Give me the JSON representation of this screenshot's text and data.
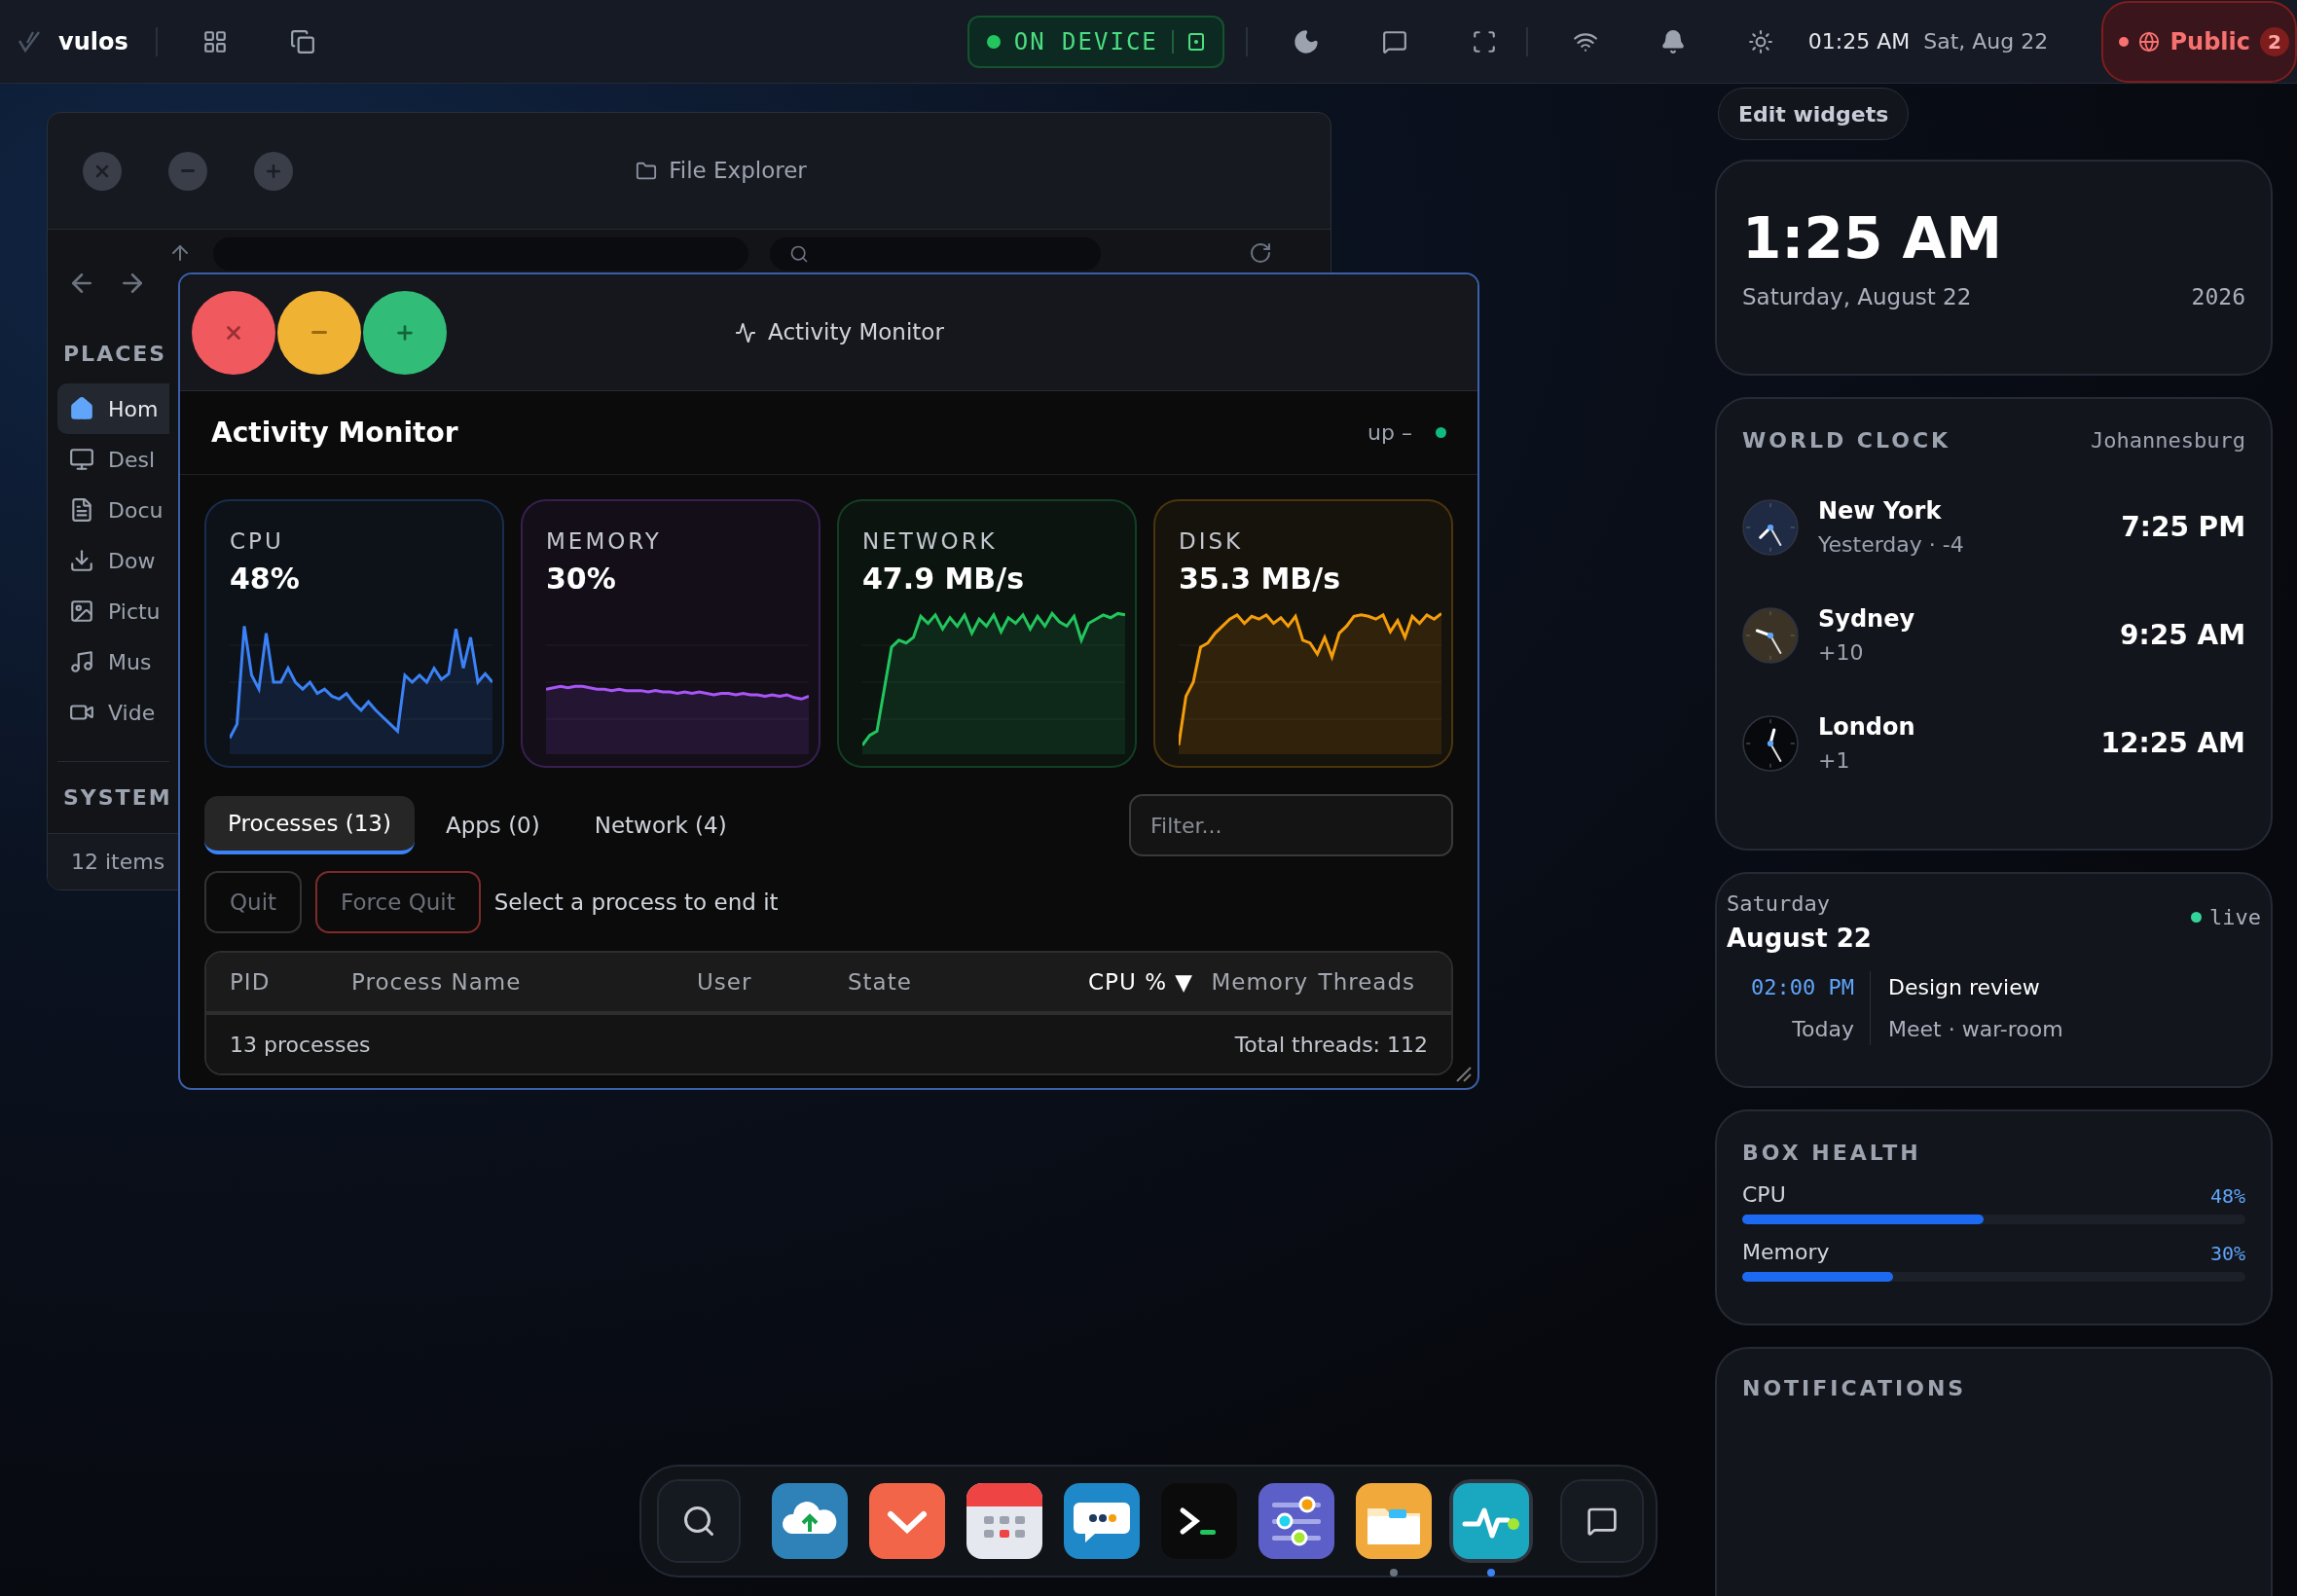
{
  "top_bar": {
    "brand": "vulos",
    "status": {
      "label": "ON DEVICE",
      "on": true
    },
    "time": "01:25 AM",
    "date": "Sat, Aug 22",
    "network": {
      "label": "Public",
      "count": "2"
    }
  },
  "file_explorer": {
    "title": "File Explorer",
    "sections": [
      {
        "heading": "PLACES",
        "items": [
          {
            "label": "Hom",
            "selected": true
          },
          {
            "label": "Desl",
            "selected": false
          },
          {
            "label": "Docu",
            "selected": false
          },
          {
            "label": "Dow",
            "selected": false
          },
          {
            "label": "Pictu",
            "selected": false
          },
          {
            "label": "Mus",
            "selected": false
          },
          {
            "label": "Vide",
            "selected": false
          }
        ]
      },
      {
        "heading": "SYSTEM"
      }
    ],
    "status": "12 items"
  },
  "activity_monitor": {
    "title": "Activity Monitor",
    "heading": "Activity Monitor",
    "uptime": "up –",
    "online": true,
    "metrics": [
      {
        "label": "CPU",
        "value": "48%",
        "color": "#3b82f6"
      },
      {
        "label": "MEMORY",
        "value": "30%",
        "color": "#a855f7"
      },
      {
        "label": "NETWORK",
        "value": "47.9 MB/s",
        "color": "#22c55e"
      },
      {
        "label": "DISK",
        "value": "35.3 MB/s",
        "color": "#f59e0b"
      }
    ],
    "tabs": [
      {
        "label": "Processes (13)",
        "selected": true
      },
      {
        "label": "Apps (0)",
        "selected": false
      },
      {
        "label": "Network (4)",
        "selected": false
      }
    ],
    "filter": {
      "placeholder": "Filter..."
    },
    "actions": [
      {
        "label": "Quit",
        "kind": "normal",
        "disabled": true
      },
      {
        "label": "Force Quit",
        "kind": "danger",
        "disabled": true
      }
    ],
    "hint": "Select a process to end it",
    "table": {
      "columns": [
        {
          "label": "PID",
          "selected": false
        },
        {
          "label": "Process Name",
          "selected": false
        },
        {
          "label": "User",
          "selected": false
        },
        {
          "label": "State",
          "selected": false
        },
        {
          "label": "CPU %",
          "selected": true,
          "arrow": "▼"
        },
        {
          "label": "Memory",
          "selected": false
        },
        {
          "label": "Threads",
          "selected": false
        }
      ],
      "footer": {
        "count": "13 processes",
        "threads": "Total threads: 112"
      }
    }
  },
  "widgets": {
    "edit_button": "Edit widgets",
    "clock": {
      "time": "1:25 AM",
      "date": "Saturday, August 22",
      "year": "2026"
    },
    "world_clock": {
      "title": "WORLD CLOCK",
      "home": "Johannesburg",
      "cities": [
        {
          "name": "New York",
          "offset": "Yesterday · -4",
          "time": "7:25 PM",
          "color": "#1f2b45"
        },
        {
          "name": "Sydney",
          "offset": "+10",
          "time": "9:25 AM",
          "color": "#3b3326"
        },
        {
          "name": "London",
          "offset": "+1",
          "time": "12:25 AM",
          "color": "#08090c"
        }
      ]
    },
    "calendar": {
      "weekday": "Saturday",
      "date": "August 22",
      "live": "live",
      "event": {
        "time": "02:00 PM",
        "day": "Today",
        "title": "Design review",
        "location": "Meet · war-room"
      }
    },
    "box_health": {
      "title": "BOX HEALTH",
      "meters": [
        {
          "label": "CPU",
          "reading": "48%",
          "level": 0.48
        },
        {
          "label": "Memory",
          "reading": "30%",
          "level": 0.3
        }
      ]
    },
    "notifications": {
      "title": "NOTIFICATIONS"
    }
  },
  "dock": {
    "items": [
      {
        "kind": "search",
        "running": false,
        "selected": false
      },
      {
        "kind": "cloud",
        "running": false,
        "selected": false
      },
      {
        "kind": "pocket",
        "running": false,
        "selected": false
      },
      {
        "kind": "calendar",
        "running": false,
        "selected": false
      },
      {
        "kind": "chat",
        "running": false,
        "selected": false
      },
      {
        "kind": "terminal",
        "running": false,
        "selected": false
      },
      {
        "kind": "settings",
        "running": false,
        "selected": false
      },
      {
        "kind": "files",
        "running": true,
        "selected": false
      },
      {
        "kind": "activity",
        "running": true,
        "selected": true
      },
      {
        "kind": "messages",
        "running": false,
        "selected": false
      }
    ]
  }
}
